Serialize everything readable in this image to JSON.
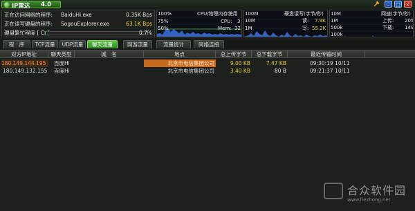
{
  "title_bar": {
    "app_name": "IP雷达",
    "version": "4.0",
    "buttons": {
      "pin": "pin-icon",
      "minimize": "–",
      "maximize": "□",
      "close": "×"
    }
  },
  "info": {
    "row1": {
      "label": "正在访问网络的程序:",
      "program": "BaiduHi.exe",
      "value": "0.35K Bps"
    },
    "row2": {
      "label": "正在读写硬盘的程序:",
      "program": "SogouExplorer.exe",
      "value": "63.1K Bps"
    },
    "row3": {
      "label": "硬盘繁忙程度 [ C: ]",
      "value": "0.7%",
      "progress_percent": 0.7
    }
  },
  "cpu_panel": {
    "top_left": "100%",
    "title": "CPU/物理内存使用",
    "mark_75": "75%",
    "cpu_label": "CPU:",
    "cpu_value": "3",
    "mark_50": "50%",
    "mem_label": "Mem:",
    "mem_value": "32"
  },
  "disk_panel": {
    "top_left": "100M",
    "title": "硬盘读写(字节/秒)",
    "mark_10m": "10M",
    "read_label": "读:",
    "read_value": "7.9K",
    "mark_1m": "1M",
    "write_label": "写:",
    "write_value": "55.2K"
  },
  "net_panel": {
    "top_left": "10M",
    "title": "网速(字节/秒)",
    "mark_1m": "1M",
    "upload_label": "上传:",
    "upload_value": "205",
    "mark_500k": "500k",
    "download_label": "下载:",
    "download_value": "149",
    "mark_100k": "100k"
  },
  "tabs": [
    {
      "label": "程　序",
      "active": false
    },
    {
      "label": "TCP流量",
      "active": false
    },
    {
      "label": "UDP流量",
      "active": false
    },
    {
      "label": "聊天流量",
      "active": true
    },
    {
      "label": "网游流量",
      "active": false
    },
    {
      "label": "流量统计",
      "active": false
    },
    {
      "label": "网络连接",
      "active": false
    }
  ],
  "table": {
    "columns": [
      "对方IP地址",
      "聊天类型",
      "城　名",
      "地点",
      "总上传字节",
      "总下载字节",
      "最近传输时间"
    ],
    "rows": [
      {
        "ip": "180.149.144.195",
        "type": "百度Hi",
        "domain": "",
        "location": "北京市电信集团公司",
        "upload": "9.00 KB",
        "download": "7.47 KB",
        "time": "09:30:19 10/11"
      },
      {
        "ip": "180.149.132.155",
        "type": "百度Hi",
        "domain": "",
        "location": "北京市电信集团公司",
        "upload": "3.40 KB",
        "download": "80 B",
        "time": "09:21:37 10/11"
      }
    ]
  },
  "watermark": {
    "text": "合众软件园",
    "url": "www.hezhong.net"
  },
  "colors": {
    "accent_green": "#3fa82e",
    "highlight_orange": "#c86a1e",
    "value_yellow": "#f0d040",
    "background": "#1d211d"
  }
}
